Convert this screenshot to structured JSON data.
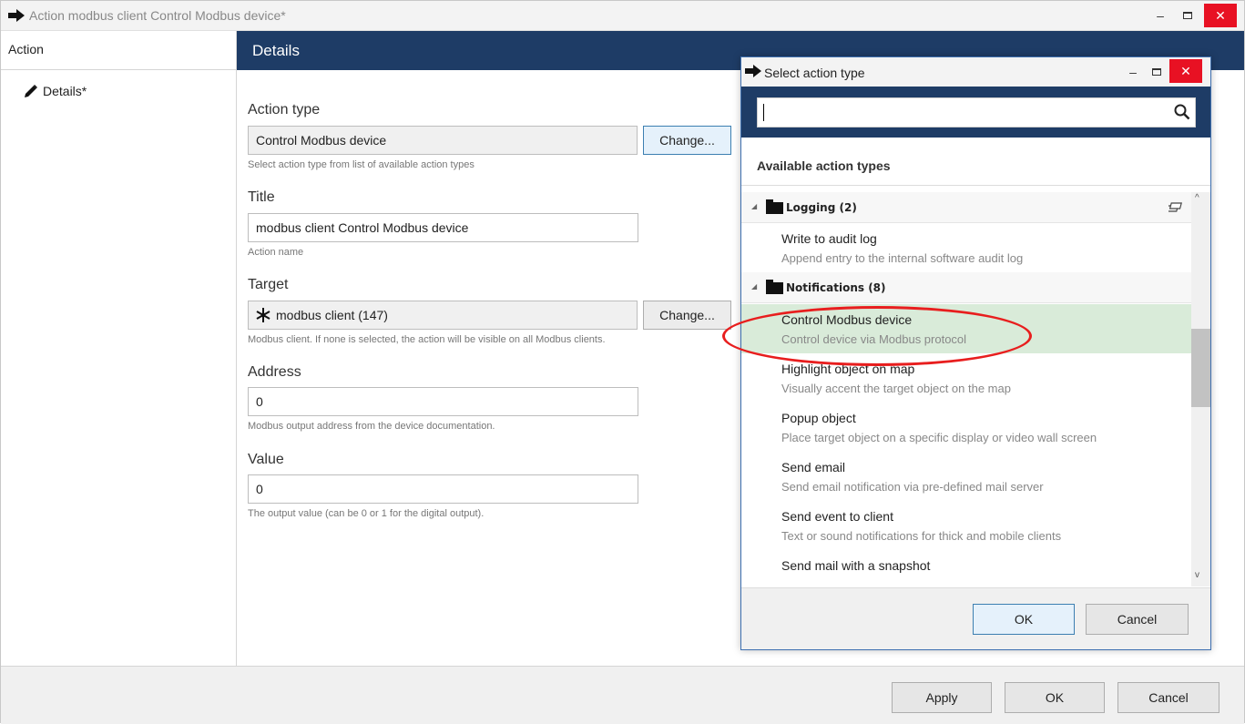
{
  "window": {
    "title": "Action modbus client Control Modbus device*",
    "minimize": "–",
    "close": "✕"
  },
  "leftnav": {
    "header": "Action",
    "items": [
      {
        "label": "Details*",
        "icon": "pencil-icon"
      }
    ]
  },
  "details": {
    "header": "Details",
    "action_type": {
      "label": "Action type",
      "value": "Control Modbus device",
      "button": "Change...",
      "help": "Select action type from list of available action types"
    },
    "title": {
      "label": "Title",
      "value": "modbus client Control Modbus device",
      "help": "Action name"
    },
    "target": {
      "label": "Target",
      "value": "modbus client (147)",
      "icon": "network-star-icon",
      "button": "Change...",
      "help": "Modbus client. If none is selected, the action will be visible on all Modbus clients."
    },
    "address": {
      "label": "Address",
      "value": "0",
      "help": "Modbus output address from the device documentation."
    },
    "value": {
      "label": "Value",
      "value": "0",
      "help": "The output value (can be 0 or 1 for the digital output)."
    }
  },
  "bottom": {
    "apply": "Apply",
    "ok": "OK",
    "cancel": "Cancel"
  },
  "dialog": {
    "title": "Select action type",
    "minimize": "–",
    "close": "✕",
    "search": {
      "value": "",
      "placeholder": ""
    },
    "available_heading": "Available action types",
    "groups": [
      {
        "label": "Logging (2)",
        "items": [
          {
            "title": "Write to audit log",
            "desc": "Append entry to the internal software audit log"
          }
        ]
      },
      {
        "label": "Notifications (8)",
        "items": [
          {
            "title": "Control Modbus device",
            "desc": "Control device via Modbus protocol",
            "selected": true
          },
          {
            "title": "Highlight object on map",
            "desc": "Visually accent the target object on the map"
          },
          {
            "title": "Popup object",
            "desc": "Place target object on a specific display or video wall screen"
          },
          {
            "title": "Send email",
            "desc": "Send email notification via pre-defined mail server"
          },
          {
            "title": "Send event to client",
            "desc": "Text or sound notifications for thick and mobile clients"
          },
          {
            "title": "Send mail with a snapshot",
            "desc": ""
          }
        ]
      }
    ],
    "ok": "OK",
    "cancel": "Cancel"
  },
  "colors": {
    "header_bg": "#1e3c66",
    "close_red": "#e81123",
    "selected_row": "#d9ebd9",
    "annotation_red": "#e81e1e"
  }
}
